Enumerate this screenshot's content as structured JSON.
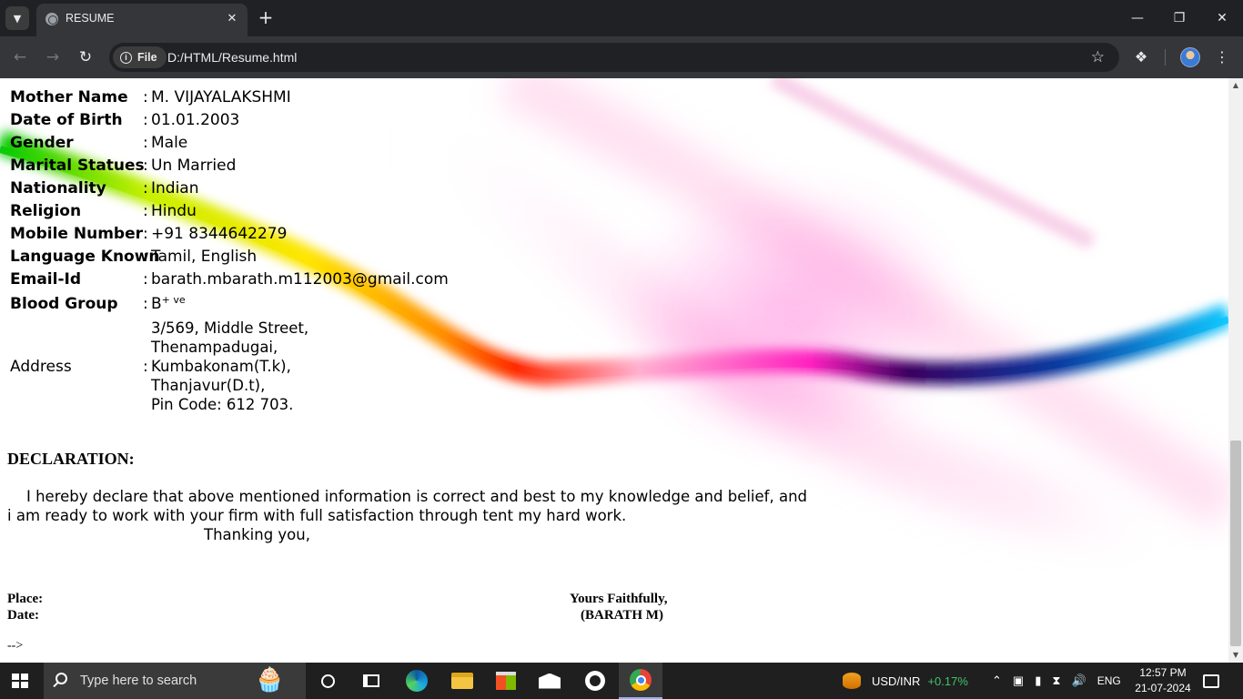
{
  "browser": {
    "tab_title": "RESUME",
    "omnibox_chip": "File",
    "url": "D:/HTML/Resume.html"
  },
  "resume": {
    "details": [
      {
        "label": "Mother Name",
        "value": "M. VIJAYALAKSHMI"
      },
      {
        "label": "Date of Birth",
        "value": "01.01.2003"
      },
      {
        "label": "Gender",
        "value": "Male"
      },
      {
        "label": "Marital Statues",
        "value": "Un Married"
      },
      {
        "label": "Nationality",
        "value": "Indian"
      },
      {
        "label": "Religion",
        "value": "Hindu"
      },
      {
        "label": "Mobile Number",
        "value": "+91 8344642279"
      },
      {
        "label": "Language Known",
        "value": "Tamil, English"
      },
      {
        "label": "Email-Id",
        "value": "barath.mbarath.m112003@gmail.com"
      }
    ],
    "blood_group": {
      "label": "Blood Group",
      "value": "B",
      "sup": "+ ve"
    },
    "address": {
      "label": "Address",
      "lines": [
        "3/569, Middle Street,",
        "Thenampadugai,",
        "Kumbakonam(T.k),",
        "Thanjavur(D.t),",
        "Pin Code: 612 703."
      ]
    },
    "colon": ":",
    "declaration_title": "DECLARATION:",
    "declaration_lines": [
      "    I hereby declare that above mentioned information is correct and best to my knowledge and belief, and",
      "i am ready to work with your firm with full satisfaction through tent my hard work."
    ],
    "thanking": "Thanking you,",
    "place_label": "Place:",
    "date_label": "Date:",
    "yours": "Yours Faithfully,",
    "signature": "(BARATH M)",
    "trailing": "-->"
  },
  "taskbar": {
    "search_placeholder": "Type here to search",
    "ticker": "USD/INR",
    "ticker_change": "+0.17%",
    "language": "ENG",
    "time": "12:57 PM",
    "date": "21-07-2024"
  },
  "colors": {
    "ticker_positive": "#3fc36a",
    "chrome_dark": "#202124",
    "chrome_toolbar": "#35363a"
  }
}
